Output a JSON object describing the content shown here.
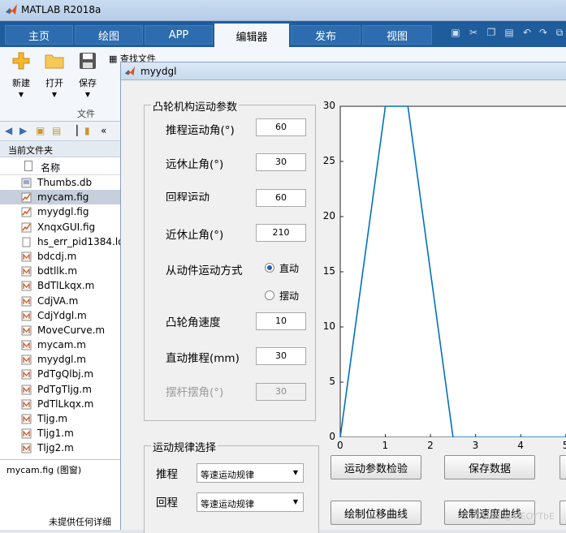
{
  "app": {
    "title": "MATLAB R2018a"
  },
  "tabs": [
    "主页",
    "绘图",
    "APP",
    "编辑器",
    "发布",
    "视图"
  ],
  "active_tab": "编辑器",
  "ribbon": {
    "new_label": "新建",
    "open_label": "打开",
    "save_label": "保存",
    "find_files_label": "查找文件",
    "file_section": "文件"
  },
  "browser": {
    "current_folder_label": "当前文件夹",
    "name_header": "名称",
    "files": [
      {
        "name": "Thumbs.db",
        "type": "db"
      },
      {
        "name": "mycam.fig",
        "type": "fig",
        "selected": true
      },
      {
        "name": "myydgl.fig",
        "type": "fig"
      },
      {
        "name": "XnqxGUI.fig",
        "type": "fig"
      },
      {
        "name": "hs_err_pid1384.lo",
        "type": "doc"
      },
      {
        "name": "bdcdj.m",
        "type": "m"
      },
      {
        "name": "bdtllk.m",
        "type": "m"
      },
      {
        "name": "BdTlLkqx.m",
        "type": "m"
      },
      {
        "name": "CdjVA.m",
        "type": "m"
      },
      {
        "name": "CdjYdgl.m",
        "type": "m"
      },
      {
        "name": "MoveCurve.m",
        "type": "m"
      },
      {
        "name": "mycam.m",
        "type": "m"
      },
      {
        "name": "myydgl.m",
        "type": "m"
      },
      {
        "name": "PdTgQlbj.m",
        "type": "m"
      },
      {
        "name": "PdTgTljg.m",
        "type": "m"
      },
      {
        "name": "PdTlLkqx.m",
        "type": "m"
      },
      {
        "name": "Tljg.m",
        "type": "m"
      },
      {
        "name": "Tljg1.m",
        "type": "m"
      },
      {
        "name": "Tljg2.m",
        "type": "m"
      }
    ],
    "details_title": "mycam.fig (图窗)",
    "details_message": "未提供任何详细"
  },
  "figure": {
    "title": "myydgl",
    "params_panel": {
      "title": "凸轮机构运动参数",
      "push_angle_label": "推程运动角(°)",
      "push_angle_value": "60",
      "far_rest_label": "远休止角(°)",
      "far_rest_value": "30",
      "return_angle_label": "回程运动",
      "return_angle_value": "60",
      "near_rest_label": "近休止角(°)",
      "near_rest_value": "210",
      "follower_mode_label": "从动件运动方式",
      "mode_translating": "直动",
      "mode_swinging": "摆动",
      "cam_speed_label": "凸轮角速度",
      "cam_speed_value": "10",
      "lift_label": "直动推程(mm)",
      "lift_value": "30",
      "swing_label": "摆杆摆角(°)",
      "swing_value": "30"
    },
    "law_panel": {
      "title": "运动规律选择",
      "push_label": "推程",
      "push_value": "等速运动规律",
      "return_label": "回程",
      "return_value": "等速运动规律"
    },
    "buttons": {
      "check": "运动参数检验",
      "save": "保存数据",
      "plot_disp": "绘制位移曲线",
      "plot_vel": "绘制速度曲线"
    }
  },
  "chart_data": {
    "type": "line",
    "x": [
      0,
      1,
      1.5,
      2.5,
      6
    ],
    "y": [
      0,
      30,
      30,
      0,
      0
    ],
    "xticks": [
      "0",
      "1",
      "2",
      "3",
      "4",
      "5"
    ],
    "yticks": [
      "0",
      "5",
      "10",
      "15",
      "20",
      "25",
      "30"
    ],
    "xlim": [
      0,
      5.4
    ],
    "ylim": [
      0,
      30
    ],
    "color": "#0072bd"
  },
  "watermark": "CSDN @MEOYTbE"
}
